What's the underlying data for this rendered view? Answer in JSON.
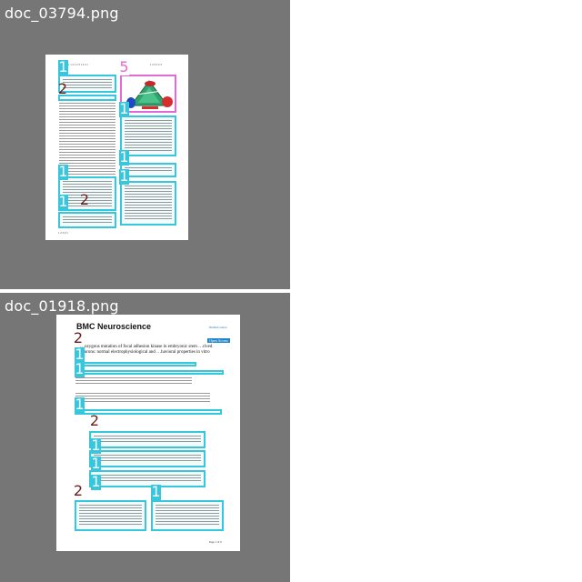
{
  "panels": [
    {
      "filename": "doc_03794.png",
      "page_header_left": "1 1 2 1 2 3 1 2 3 1",
      "page_header_right": "1 2 3 1 2 3",
      "footer": "1 2 3 4 5",
      "region_labels": [
        "1",
        "2",
        "5",
        "1",
        "1",
        "1",
        "1",
        "1",
        "2"
      ]
    },
    {
      "filename": "doc_01918.png",
      "journal_title": "BMC Neuroscience",
      "logo_text": "BioMed Central",
      "open_access_badge": "Open Access",
      "article_title": "…ozygous mutation of focal adhesion kinase in embryonic stem …rived neurons: normal electrophysiological and …havioral properties in vitro",
      "footer_text": "Page 1 of 9",
      "region_labels": [
        "2",
        "1",
        "1",
        "1",
        "2",
        "1",
        "1",
        "1",
        "2",
        "1"
      ]
    }
  ],
  "colors": {
    "panel_background": "#767676",
    "box_text": "#36c7de",
    "box_figure": "#e26ad6",
    "label_dark": "#6b1d1d"
  }
}
